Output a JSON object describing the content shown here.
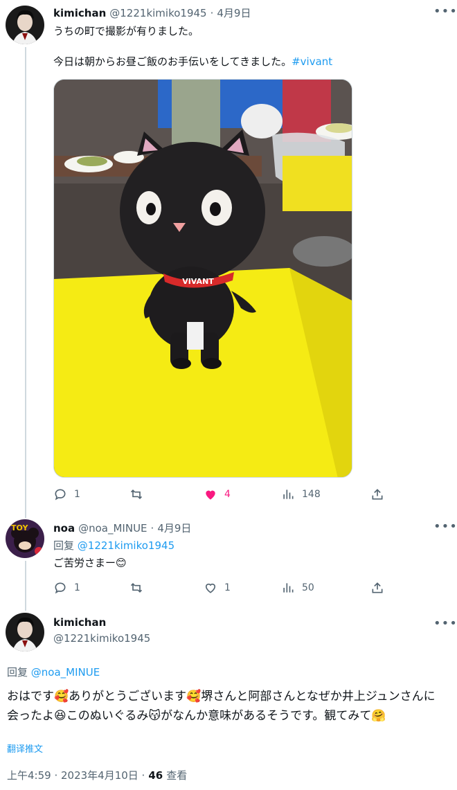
{
  "tweet1": {
    "name": "kimichan",
    "handle": "@1221kimiko1945",
    "sep": "·",
    "date": "4月9日",
    "line1": "うちの町で撮影が有りました。",
    "line2": "今日は朝からお昼ご飯のお手伝いをしてきました。",
    "hashtag": "#vivant",
    "photo_text": "VIVANT",
    "stats": {
      "replies": "1",
      "retweets": "",
      "likes": "4",
      "views": "148"
    }
  },
  "tweet2": {
    "name": "noa",
    "handle": "@noa_MINUE",
    "sep": "·",
    "date": "4月9日",
    "reply_prefix": "回复",
    "reply_to": "@1221kimiko1945",
    "text": "ご苦労さまー😊",
    "stats": {
      "replies": "1",
      "retweets": "",
      "likes": "1",
      "views": "50"
    }
  },
  "main": {
    "name": "kimichan",
    "handle": "@1221kimiko1945",
    "reply_prefix": "回复",
    "reply_to": "@noa_MINUE",
    "text": "おはです🥰ありがとうございます🥰堺さんと阿部さんとなぜか井上ジュンさんに会ったよ😆このぬいぐるみ😽がなんか意味があるそうです。観てみて🤗",
    "translate": "翻译推文",
    "time": "上午4:59 · 2023年4月10日 ·",
    "views_count": "46",
    "views_label": "查看"
  },
  "colors": {
    "accent": "#1d9bf0",
    "like": "#f91880",
    "muted": "#536471"
  }
}
